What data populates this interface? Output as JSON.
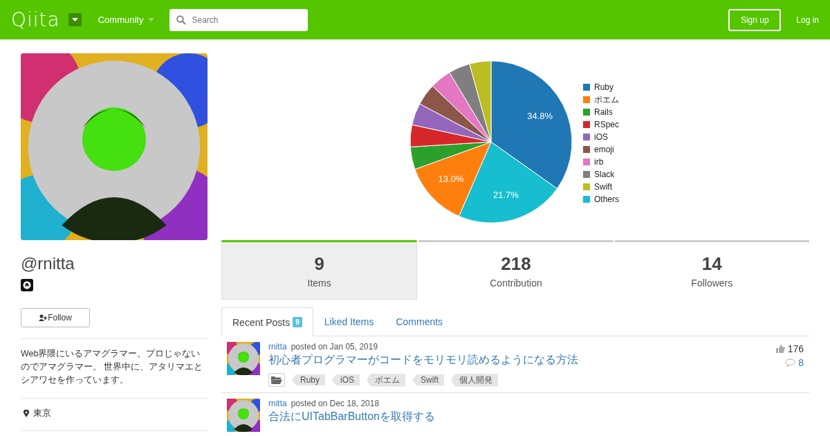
{
  "header": {
    "logo": "Qiita",
    "community": "Community",
    "search": {
      "placeholder": "Search"
    },
    "signup": "Sign up",
    "login": "Log in"
  },
  "profile": {
    "username": "@rnitta",
    "follow": "Follow",
    "bio": "Web界隈にいるアマグラマー。プロじゃないのでアマグラマー。 世界中に、アタリマエとシアワセを作っています。",
    "location": "東京"
  },
  "chart_data": {
    "type": "pie",
    "legend": "right",
    "categories": [
      "Ruby",
      "ポエム",
      "Rails",
      "RSpec",
      "iOS",
      "emoji",
      "irb",
      "Slack",
      "Swift",
      "Others"
    ],
    "values": [
      34.8,
      13.0,
      4.5,
      4.4,
      4.4,
      4.3,
      4.3,
      4.3,
      4.3,
      21.7
    ],
    "colors": [
      "#1f77b4",
      "#ff7f0e",
      "#2ca02c",
      "#d62728",
      "#9467bd",
      "#8c564b",
      "#e377c2",
      "#7f7f7f",
      "#bcbd22",
      "#17becf"
    ],
    "value_labels": [
      "34.8%",
      "13.0%",
      null,
      null,
      null,
      null,
      null,
      null,
      null,
      "21.7%"
    ]
  },
  "stats": [
    {
      "value": "9",
      "label": "Items",
      "selected": true
    },
    {
      "value": "218",
      "label": "Contribution",
      "selected": false
    },
    {
      "value": "14",
      "label": "Followers",
      "selected": false
    }
  ],
  "tabs": [
    {
      "label": "Recent Posts",
      "count": "9",
      "selected": true
    },
    {
      "label": "Liked Items",
      "selected": false
    },
    {
      "label": "Comments",
      "selected": false
    }
  ],
  "posts": [
    {
      "author": "rnitta",
      "posted": "posted on Jan 05, 2019",
      "title": "初心者プログラマーがコードをモリモリ読めるようになる方法",
      "tags": [
        "Ruby",
        "iOS",
        "ポエム",
        "Swift",
        "個人開発"
      ],
      "likes": "176",
      "comments": "8"
    },
    {
      "author": "rnitta",
      "posted": "posted on Dec 18, 2018",
      "title": "合法にUITabBarButtonを取得する"
    }
  ]
}
